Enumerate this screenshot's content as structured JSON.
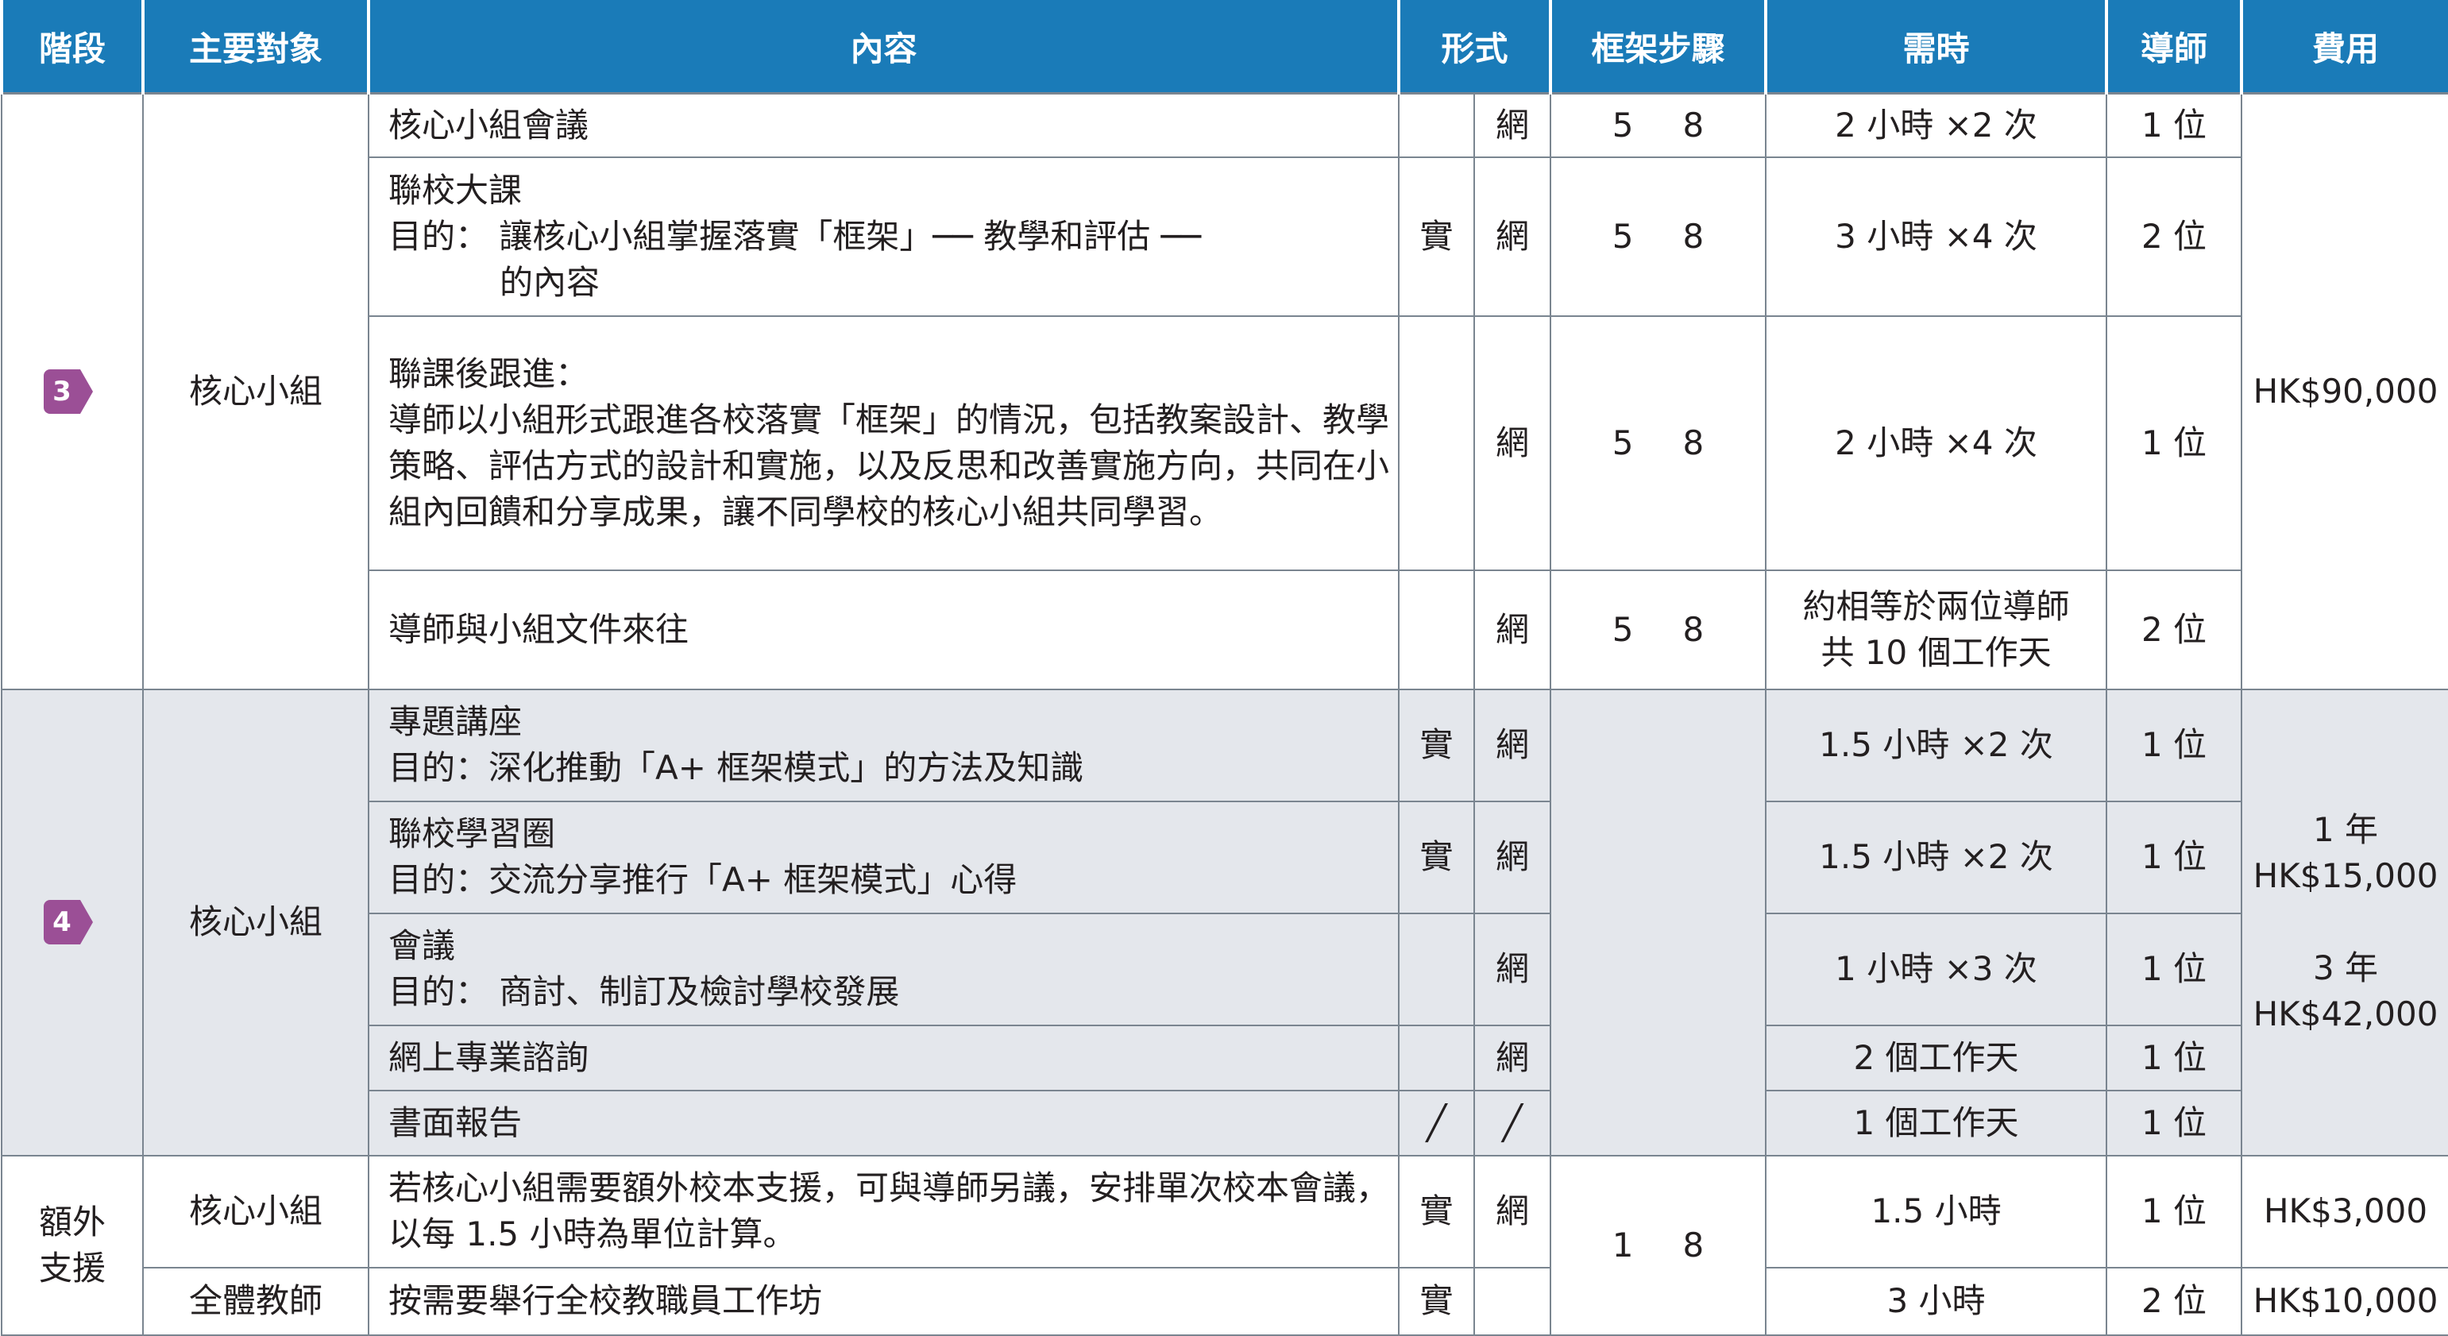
{
  "headers": {
    "stage": "階段",
    "target": "主要對象",
    "content": "內容",
    "format": "形式",
    "framework": "框架步驟",
    "time": "需時",
    "tutor": "導師",
    "fee": "費用"
  },
  "badge_color": "#9b4f96",
  "header_color": "#1a7bb8",
  "stage3": {
    "badge": "3",
    "target": "核心小組",
    "fee": "HK$90,000",
    "rows": [
      {
        "content": "核心小組會議",
        "f1": "",
        "f2": "網",
        "s1": "5",
        "s2": "8",
        "time": "2 小時 ×2 次",
        "tutor": "1 位"
      },
      {
        "content_l1": "聯校大課",
        "content_l2": "目的： 讓核心小組掌握落實「框架」── 教學和評估 ──",
        "content_l3": "的內容",
        "f1": "實",
        "f2": "網",
        "s1": "5",
        "s2": "8",
        "time": "3 小時 ×4 次",
        "tutor": "2 位"
      },
      {
        "content_l1": "聯課後跟進：",
        "content_l2": "導師以小組形式跟進各校落實「框架」的情況，包括教案設計、教學策略、評估方式的設計和實施，以及反思和改善實施方向，共同在小組內回饋和分享成果，讓不同學校的核心小組共同學習。",
        "f1": "",
        "f2": "網",
        "s1": "5",
        "s2": "8",
        "time": "2 小時 ×4 次",
        "tutor": "1 位"
      },
      {
        "content": "導師與小組文件來往",
        "f1": "",
        "f2": "網",
        "s1": "5",
        "s2": "8",
        "time_l1": "約相等於兩位導師",
        "time_l2": "共 10 個工作天",
        "tutor": "2 位"
      }
    ]
  },
  "stage4": {
    "badge": "4",
    "target": "核心小組",
    "fee_1y_label": "1 年",
    "fee_1y": "HK$15,000",
    "fee_3y_label": "3 年",
    "fee_3y": "HK$42,000",
    "rows": [
      {
        "content_l1": "專題講座",
        "content_l2": "目的：深化推動「A+ 框架模式」的方法及知識",
        "f1": "實",
        "f2": "網",
        "time": "1.5 小時 ×2 次",
        "tutor": "1 位"
      },
      {
        "content_l1": "聯校學習圈",
        "content_l2": "目的：交流分享推行「A+ 框架模式」心得",
        "f1": "實",
        "f2": "網",
        "time": "1.5 小時 ×2 次",
        "tutor": "1 位"
      },
      {
        "content_l1": "會議",
        "content_l2": "目的： 商討、制訂及檢討學校發展",
        "f1": "",
        "f2": "網",
        "time": "1 小時 ×3 次",
        "tutor": "1 位"
      },
      {
        "content": "網上專業諮詢",
        "f1": "",
        "f2": "網",
        "time": "2 個工作天",
        "tutor": "1 位"
      },
      {
        "content": "書面報告",
        "f1": "╱",
        "f2": "╱",
        "time": "1 個工作天",
        "tutor": "1 位"
      }
    ]
  },
  "extra": {
    "stage_l1": "額外",
    "stage_l2": "支援",
    "s1": "1",
    "s2": "8",
    "rows": [
      {
        "target": "核心小組",
        "content": "若核心小組需要額外校本支援，可與導師另議，安排單次校本會議，以每 1.5 小時為單位計算。",
        "f1": "實",
        "f2": "網",
        "time": "1.5 小時",
        "tutor": "1 位",
        "fee": "HK$3,000"
      },
      {
        "target": "全體教師",
        "content": "按需要舉行全校教職員工作坊",
        "f1": "實",
        "f2": "",
        "time": "3 小時",
        "tutor": "2 位",
        "fee": "HK$10,000"
      }
    ]
  }
}
